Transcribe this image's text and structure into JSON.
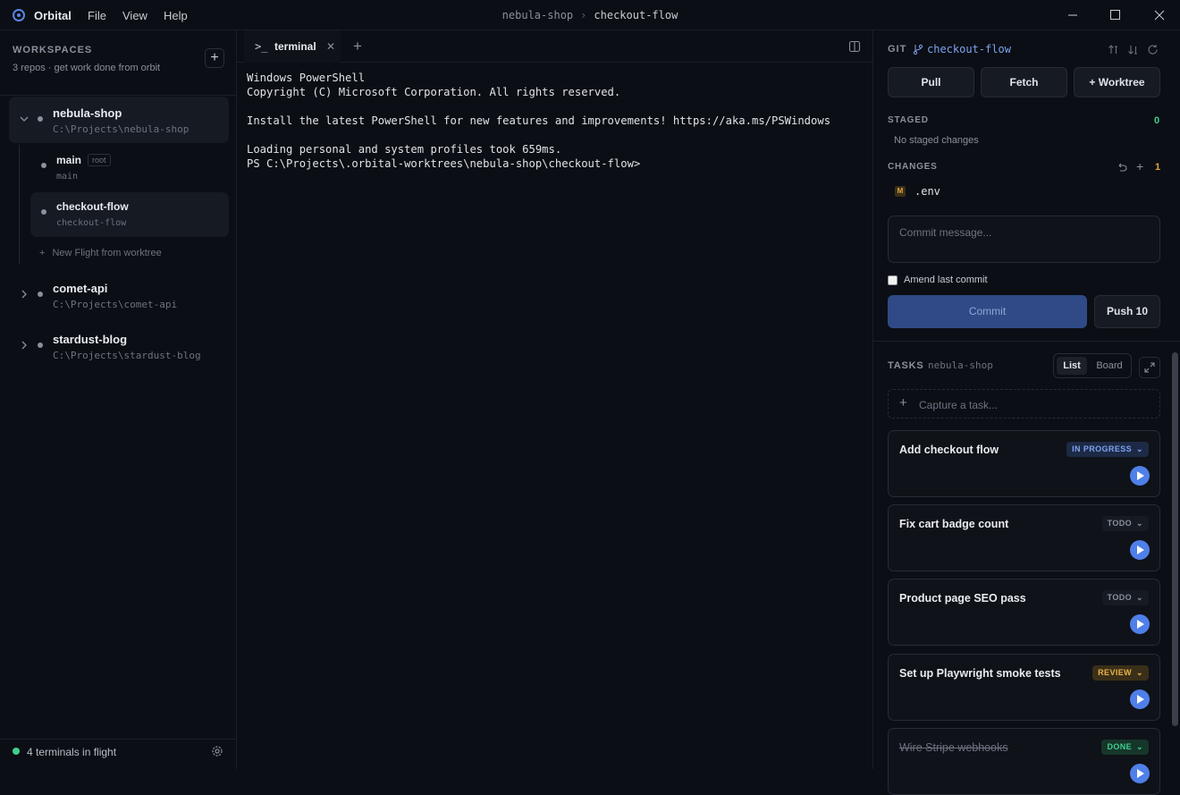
{
  "app": {
    "name": "Orbital",
    "menu": [
      "File",
      "View",
      "Help"
    ]
  },
  "breadcrumb": {
    "repo": "nebula-shop",
    "separator": "›",
    "worktree": "checkout-flow"
  },
  "sidebar": {
    "title": "WORKSPACES",
    "subtitle": "3 repos · get work done from orbit",
    "add_label": "+",
    "repos": [
      {
        "name": "nebula-shop",
        "path": "C:\\Projects\\nebula-shop",
        "expanded": true
      },
      {
        "name": "comet-api",
        "path": "C:\\Projects\\comet-api",
        "expanded": false
      },
      {
        "name": "stardust-blog",
        "path": "C:\\Projects\\stardust-blog",
        "expanded": false
      }
    ],
    "worktrees": [
      {
        "name": "main",
        "badge": "root",
        "branch": "main"
      },
      {
        "name": "checkout-flow",
        "branch": "checkout-flow"
      }
    ],
    "new_flight": "New Flight from worktree",
    "footer": {
      "status": "4 terminals in flight",
      "status_color": "#3ecf8e"
    }
  },
  "terminal": {
    "tab_label": "terminal",
    "lines": [
      "Windows PowerShell",
      "Copyright (C) Microsoft Corporation. All rights reserved.",
      "",
      "Install the latest PowerShell for new features and improvements! https://aka.ms/PSWindows",
      "",
      "Loading personal and system profiles took 659ms.",
      "PS C:\\Projects\\.orbital-worktrees\\nebula-shop\\checkout-flow>"
    ]
  },
  "git": {
    "label": "GIT",
    "branch": "checkout-flow",
    "buttons": {
      "pull": "Pull",
      "fetch": "Fetch",
      "worktree": "+ Worktree"
    },
    "staged": {
      "label": "STAGED",
      "count": "0",
      "empty": "No staged changes"
    },
    "changes": {
      "label": "CHANGES",
      "count": "1",
      "files": [
        {
          "status": "M",
          "name": ".env"
        }
      ]
    },
    "commit_placeholder": "Commit message...",
    "amend_label": "Amend last commit",
    "commit_label": "Commit",
    "push_label": "Push 10"
  },
  "tasks": {
    "label": "TASKS",
    "repo": "nebula-shop",
    "views": {
      "list": "List",
      "board": "Board",
      "active": "List"
    },
    "capture_placeholder": "Capture a task...",
    "items": [
      {
        "title": "Add checkout flow",
        "status": "IN PROGRESS"
      },
      {
        "title": "Fix cart badge count",
        "status": "TODO"
      },
      {
        "title": "Product page SEO pass",
        "status": "TODO"
      },
      {
        "title": "Set up Playwright smoke tests",
        "status": "REVIEW"
      },
      {
        "title": "Wire Stripe webhooks",
        "status": "DONE"
      }
    ]
  },
  "colors": {
    "accent": "#5a84e6",
    "success": "#3ecf8e",
    "warning": "#e0a43a",
    "background": "#0b0e14"
  }
}
